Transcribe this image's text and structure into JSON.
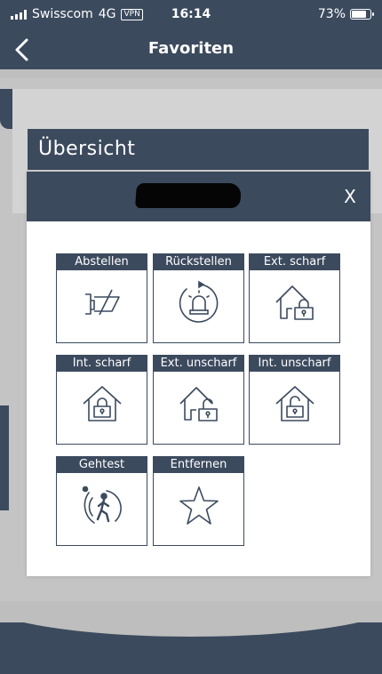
{
  "status_bar": {
    "carrier": "Swisscom",
    "network": "4G",
    "vpn": "VPN",
    "time": "16:14",
    "battery": "73%"
  },
  "nav": {
    "title": "Favoriten",
    "back_icon": "chevron-left-icon"
  },
  "section": {
    "title": "Übersicht"
  },
  "modal": {
    "close_label": "X",
    "tiles": [
      {
        "label": "Abstellen",
        "icon": "power-off-icon"
      },
      {
        "label": "Rückstellen",
        "icon": "reset-siren-icon"
      },
      {
        "label": "Ext. scharf",
        "icon": "house-lock-ext-icon"
      },
      {
        "label": "Int. scharf",
        "icon": "house-lock-int-icon"
      },
      {
        "label": "Ext. unscharf",
        "icon": "house-unlock-ext-icon"
      },
      {
        "label": "Int. unscharf",
        "icon": "house-unlock-int-icon"
      },
      {
        "label": "Gehtest",
        "icon": "walk-test-icon"
      },
      {
        "label": "Entfernen",
        "icon": "star-icon"
      }
    ]
  },
  "colors": {
    "primary": "#3c4a5e",
    "background": "#bebebe",
    "surface": "#ffffff"
  }
}
